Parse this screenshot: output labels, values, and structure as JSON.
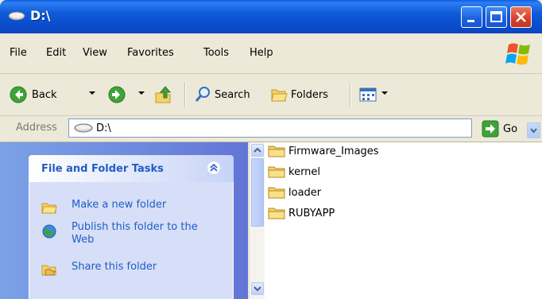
{
  "window": {
    "title": "D:\\"
  },
  "menu": {
    "file": "File",
    "edit": "Edit",
    "view": "View",
    "favorites": "Favorites",
    "tools": "Tools",
    "help": "Help"
  },
  "toolbar": {
    "back": "Back",
    "search": "Search",
    "folders": "Folders"
  },
  "address": {
    "label": "Address",
    "value": "D:\\",
    "go": "Go"
  },
  "task_pane": {
    "title": "File and Folder Tasks",
    "items": [
      {
        "label": "Make a new folder",
        "icon": "new-folder-icon"
      },
      {
        "label": "Publish this folder to the Web",
        "icon": "publish-web-icon"
      },
      {
        "label": "Share this folder",
        "icon": "share-folder-icon"
      }
    ]
  },
  "files": [
    {
      "name": "Firmware_Images"
    },
    {
      "name": "kernel"
    },
    {
      "name": "loader"
    },
    {
      "name": "RUBYAPP"
    }
  ],
  "colors": {
    "titlebar": "#0a4fcf",
    "task_link": "#215dc6",
    "task_pane_bg": "#6375d6"
  }
}
